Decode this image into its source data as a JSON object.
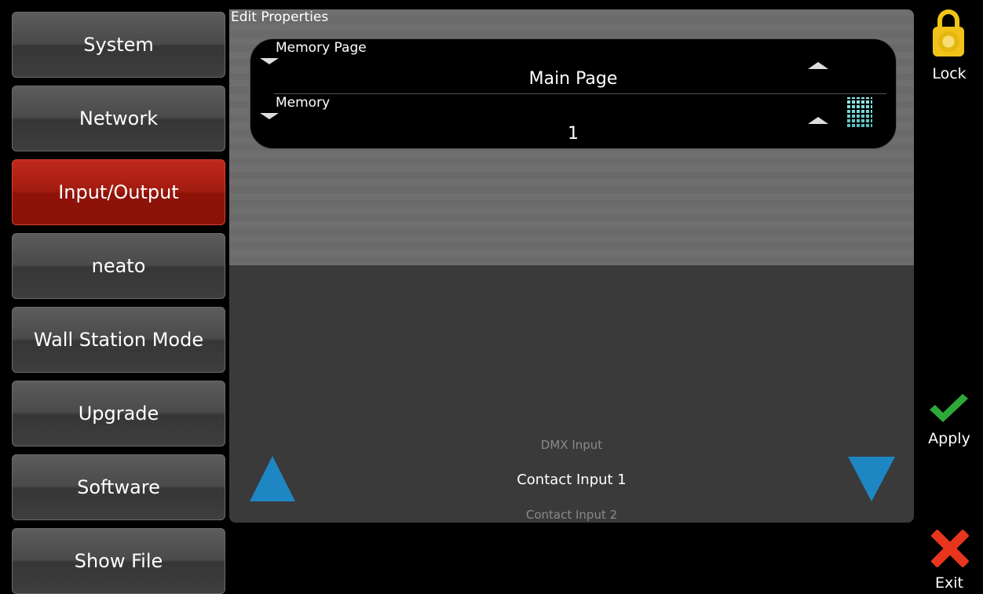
{
  "sidebar": {
    "items": [
      {
        "label": "System",
        "active": false
      },
      {
        "label": "Network",
        "active": false
      },
      {
        "label": "Input/Output",
        "active": true
      },
      {
        "label": "neato",
        "active": false
      },
      {
        "label": "Wall Station Mode",
        "active": false
      },
      {
        "label": "Upgrade",
        "active": false
      },
      {
        "label": "Software",
        "active": false
      },
      {
        "label": "Show File",
        "active": false
      }
    ]
  },
  "panel": {
    "title": "Edit Properties",
    "properties": [
      {
        "label": "Memory Page",
        "value": "Main Page"
      },
      {
        "label": "Memory",
        "value": "1"
      }
    ],
    "list": {
      "previous": "DMX Input",
      "current": "Contact Input 1",
      "next": "Contact Input 2"
    }
  },
  "actions": {
    "lock_label": "Lock",
    "apply_label": "Apply",
    "exit_label": "Exit"
  },
  "colors": {
    "active_nav": "#a21b10",
    "arrow": "#1f86c4",
    "lock": "#f0c417",
    "apply": "#2fa83a",
    "exit": "#e8361e"
  }
}
